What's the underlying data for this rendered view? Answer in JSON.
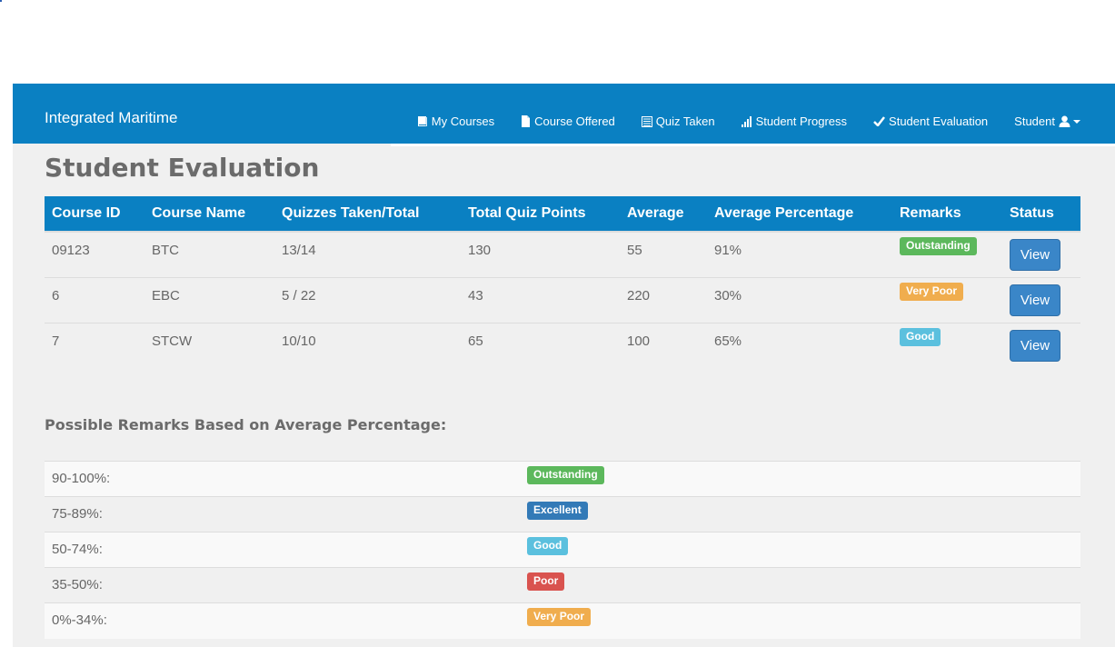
{
  "navbar": {
    "brand": "Integrated Maritime",
    "items": [
      {
        "label": "My Courses",
        "icon": "book-icon"
      },
      {
        "label": "Course Offered",
        "icon": "file-icon"
      },
      {
        "label": "Quiz Taken",
        "icon": "list-icon"
      },
      {
        "label": "Student Progress",
        "icon": "signal-bars-icon"
      },
      {
        "label": "Student Evaluation",
        "icon": "checkmark-icon"
      },
      {
        "label": "Student",
        "icon": "user-icon"
      }
    ]
  },
  "page": {
    "title": "Student Evaluation"
  },
  "table": {
    "headers": [
      "Course ID",
      "Course Name",
      "Quizzes Taken/Total",
      "Total Quiz Points",
      "Average",
      "Average Percentage",
      "Remarks",
      "Status"
    ],
    "rows": [
      {
        "course_id": "09123",
        "course_name": "BTC",
        "quizzes": "13/14",
        "points": "130",
        "average": "55",
        "percentage": "91%",
        "remark": "Outstanding",
        "remark_color": "#5cb85c",
        "status": "View"
      },
      {
        "course_id": "6",
        "course_name": "EBC",
        "quizzes": "5 / 22",
        "points": "43",
        "average": "220",
        "percentage": "30%",
        "remark": "Very Poor",
        "remark_color": "#f0ad4e",
        "status": "View"
      },
      {
        "course_id": "7",
        "course_name": "STCW",
        "quizzes": "10/10",
        "points": "65",
        "average": "100",
        "percentage": "65%",
        "remark": "Good",
        "remark_color": "#5bc0de",
        "status": "View"
      }
    ]
  },
  "remarks_guide": {
    "heading": "Possible Remarks Based on Average Percentage:",
    "items": [
      {
        "range": "90-100%:",
        "label": "Outstanding",
        "color": "#5cb85c"
      },
      {
        "range": "75-89%:",
        "label": "Excellent",
        "color": "#337ab7"
      },
      {
        "range": "50-74%:",
        "label": "Good",
        "color": "#5bc0de"
      },
      {
        "range": "35-50%:",
        "label": "Poor",
        "color": "#d9534f"
      },
      {
        "range": "0%-34%:",
        "label": "Very Poor",
        "color": "#f0ad4e"
      }
    ]
  },
  "colors": {
    "navbar": "#0a80c2",
    "table_header": "#0a80c2",
    "view_button": "#3a86c8",
    "content_bg": "#f0f0f0"
  }
}
